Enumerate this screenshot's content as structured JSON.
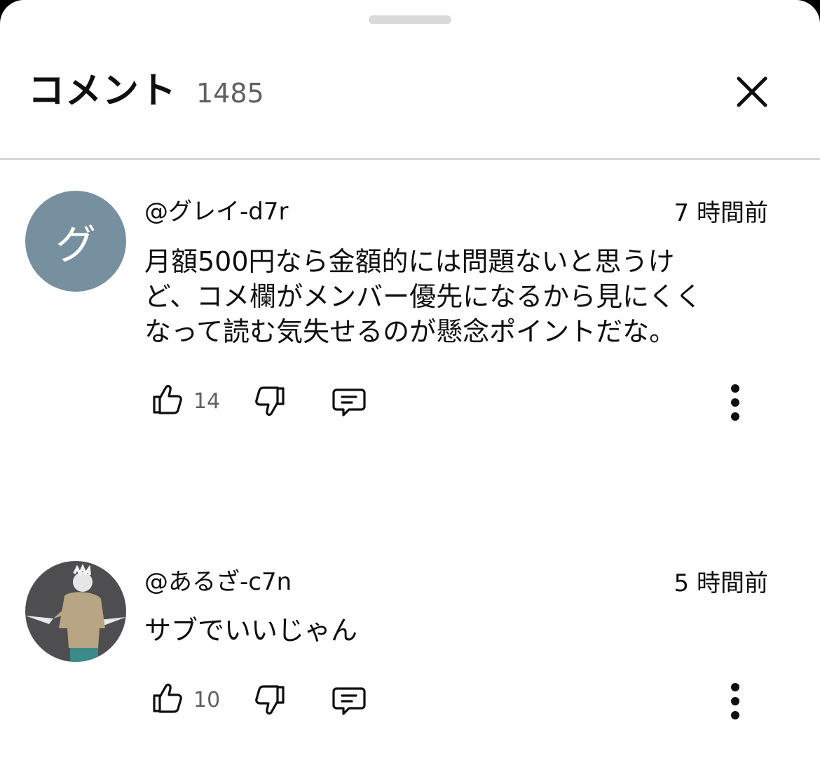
{
  "header": {
    "title": "コメント",
    "count": "1485"
  },
  "comments": [
    {
      "avatar_letter": "グ",
      "author": "@グレイ-d7r",
      "time": "7 時間前",
      "text": "月額500円なら金額的には問題ないと思うけ\nど、コメ欄がメンバー優先になるから見にくく\nなって読む気失せるのが懸念ポイントだな。",
      "likes": "14"
    },
    {
      "avatar_letter": "",
      "author": "@あるざ-c7n",
      "time": "5 時間前",
      "text": "サブでいいじゃん",
      "likes": "10"
    }
  ],
  "colors": {
    "avatar_bg": "#7690a0",
    "secondary_text": "#606060",
    "divider": "#d6d6d6"
  },
  "icons": [
    "close-icon",
    "like-icon",
    "dislike-icon",
    "reply-icon",
    "more-vert-icon"
  ]
}
